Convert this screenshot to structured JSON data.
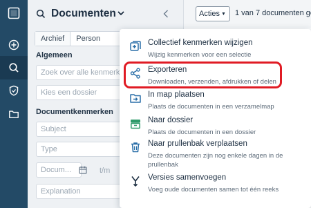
{
  "rail": {
    "items": [
      {
        "name": "logo-icon"
      },
      {
        "name": "add-icon"
      },
      {
        "name": "search-icon"
      },
      {
        "name": "shield-icon"
      },
      {
        "name": "folder-icon"
      }
    ]
  },
  "panel": {
    "title": "Documenten",
    "tabs": [
      "Archief",
      "Person"
    ],
    "general_section": "Algemeen",
    "search_placeholder": "Zoek over alle kenmerken",
    "dossier_placeholder": "Kies een dossier",
    "properties_section": "Documentkenmerken",
    "subject_placeholder": "Subject",
    "type_placeholder": "Type",
    "date_placeholder": "Docum...",
    "date_range_sep": "t/m",
    "explanation_placeholder": "Explanation"
  },
  "toolbar": {
    "actions_label": "Acties",
    "count_text": "1 van 7 documenten ge"
  },
  "menu": {
    "items": [
      {
        "icon": "bulk-edit-icon",
        "label": "Collectief kenmerken wijzigen",
        "description": "Wijzig kenmerken voor een selectie"
      },
      {
        "icon": "share-icon",
        "label": "Exporteren",
        "description": "Downloaden, verzenden, afdrukken of delen"
      },
      {
        "icon": "move-to-folder-icon",
        "label": "In map plaatsen",
        "description": "Plaats de documenten in een verzamelmap"
      },
      {
        "icon": "to-dossier-icon",
        "label": "Naar dossier",
        "description": "Plaats de documenten in een dossier"
      },
      {
        "icon": "trash-icon",
        "label": "Naar prullenbak verplaatsen",
        "description": "Deze documenten zijn nog enkele dagen in de prullenbak"
      },
      {
        "icon": "merge-icon",
        "label": "Versies samenvoegen",
        "description": "Voeg oude documenten samen tot één reeks"
      }
    ]
  },
  "colors": {
    "rail": "#234a66",
    "highlight": "#e01b24",
    "icon_blue": "#2a6fa8",
    "icon_green": "#2e9a6a"
  }
}
